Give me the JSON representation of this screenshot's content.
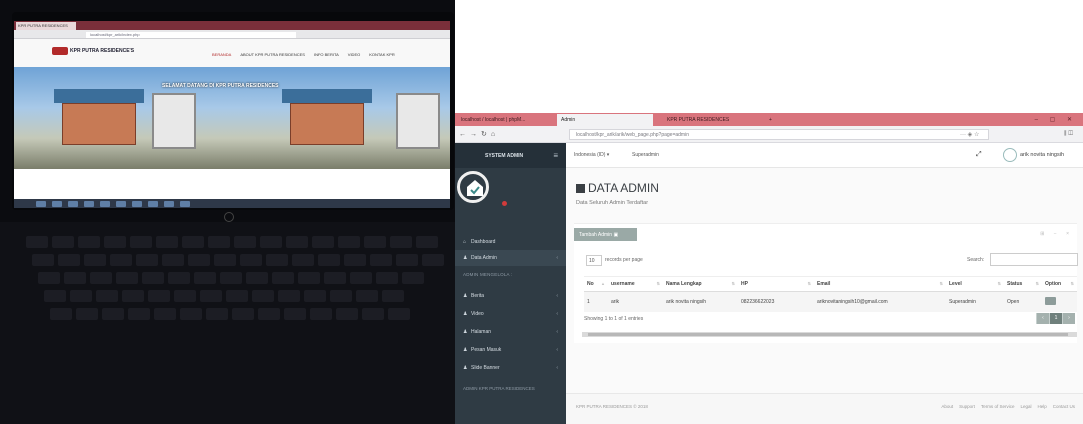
{
  "laptop_screen": {
    "tab_title": "KPR PUTRA RESIDENCES",
    "url": "localhost/kpr_arik/index.php",
    "brand": "KPR PUTRA RESIDENCE'S",
    "nav": [
      "BERANDA",
      "ABOUT KPR PUTRA RESIDENCES",
      "INFO BERITA",
      "VIDEO",
      "KONTAK KPR"
    ],
    "hero_text": "SELAMAT DATANG DI KPR PUTRA RESIDENCES"
  },
  "browser": {
    "tabs": [
      {
        "label": "localhost / localhost | phpM..."
      },
      {
        "label": "Admin"
      },
      {
        "label": "KPR PUTRA RESIDENCES"
      }
    ],
    "new_tab": "+",
    "url": "localhost/kpr_arik/arik/web_page.php?page=admin",
    "window_controls": "–  ▢  ✕"
  },
  "sidebar": {
    "title": "SYSTEM ADMIN",
    "items": [
      {
        "label": "Dashboard",
        "icon": "home-icon"
      },
      {
        "label": "Data Admin",
        "icon": "user-icon"
      }
    ],
    "section_label": "ADMIN MENGELOLA :",
    "menu": [
      {
        "label": "Berita"
      },
      {
        "label": "Video"
      },
      {
        "label": "Halaman"
      },
      {
        "label": "Pesan Masuk"
      },
      {
        "label": "Slide Banner"
      }
    ],
    "footer": "ADMIN KPR PUTRA RESIDENCES"
  },
  "topbar": {
    "language": "Indonesia (ID) ▾",
    "role": "Superadmin",
    "user": "arik novita ningsih"
  },
  "page": {
    "title": "DATA ADMIN",
    "subtitle": "Data Seluruh Admin Terdaftar",
    "add_button": "Tambah Admin"
  },
  "datatable": {
    "length_value": "10",
    "length_label": "records per page",
    "search_label": "Search:",
    "search_value": "",
    "columns": [
      "No",
      "username",
      "Nama Lengkap",
      "HP",
      "Email",
      "Level",
      "Status",
      "Option"
    ],
    "rows": [
      [
        "1",
        "arik",
        "arik novita ningsih",
        "082236622023",
        "ariknovitaningsih10@gmail.com",
        "Superadmin",
        "Open",
        ""
      ]
    ],
    "info": "Showing 1 to 1 of 1 entries",
    "pager": [
      "‹",
      "1",
      "›"
    ]
  },
  "footer": {
    "copyright": "KPR PUTRA RESIDENCES © 2018",
    "links": [
      "About",
      "Support",
      "Terms of Service",
      "Legal",
      "Help",
      "Contact Us"
    ]
  },
  "colors": {
    "browser_titlebar": "#d9747d",
    "sidebar_bg": "#2f3b44",
    "add_button": "#9aa9a6"
  }
}
